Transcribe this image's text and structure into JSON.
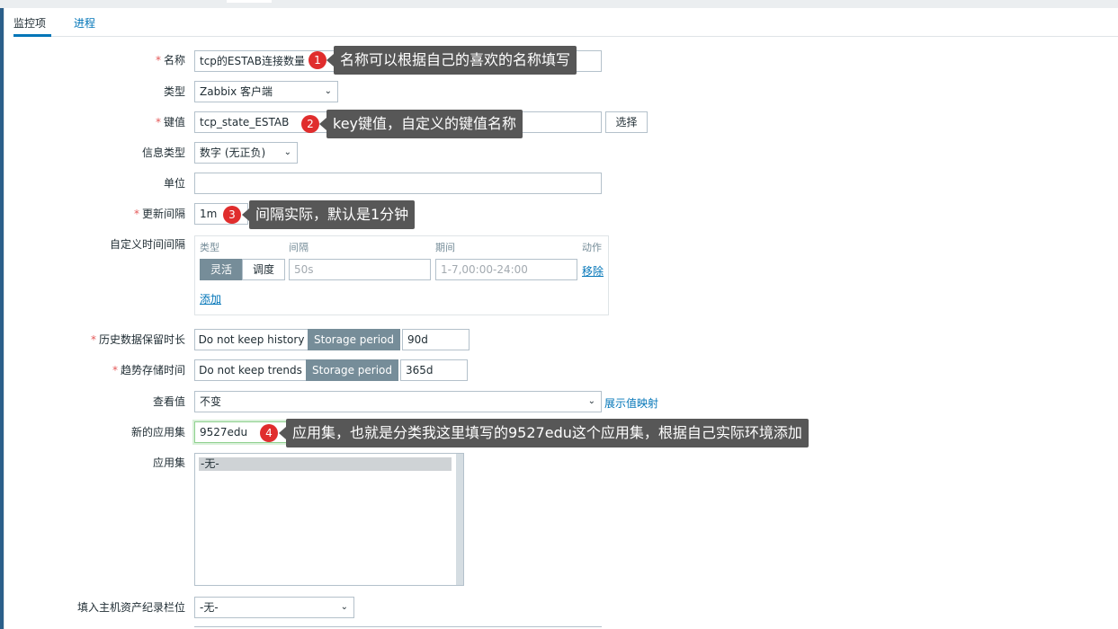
{
  "tabs": [
    {
      "label": "监控项"
    },
    {
      "label": "进程"
    }
  ],
  "form": {
    "name": {
      "label": "名称",
      "value": "tcp的ESTAB连接数量"
    },
    "type": {
      "label": "类型",
      "value": "Zabbix 客户端"
    },
    "key": {
      "label": "键值",
      "value": "tcp_state_ESTAB",
      "select_btn": "选择"
    },
    "info_type": {
      "label": "信息类型",
      "value": "数字 (无正负)"
    },
    "units": {
      "label": "单位",
      "value": ""
    },
    "interval": {
      "label": "更新间隔",
      "value": "1m"
    },
    "custom_intervals": {
      "label": "自定义时间间隔",
      "headers": {
        "type": "类型",
        "interval": "间隔",
        "period": "期间",
        "action": "动作"
      },
      "mode_flexible": "灵活",
      "mode_scheduling": "调度",
      "interval_placeholder": "50s",
      "period_placeholder": "1-7,00:00-24:00",
      "remove": "移除",
      "add": "添加"
    },
    "history": {
      "label": "历史数据保留时长",
      "opt1": "Do not keep history",
      "opt2": "Storage period",
      "value": "90d"
    },
    "trends": {
      "label": "趋势存储时间",
      "opt1": "Do not keep trends",
      "opt2": "Storage period",
      "value": "365d"
    },
    "valuemap": {
      "label": "查看值",
      "value": "不变",
      "link": "展示值映射"
    },
    "new_app": {
      "label": "新的应用集",
      "value": "9527edu"
    },
    "apps": {
      "label": "应用集",
      "option": "-无-"
    },
    "inventory": {
      "label": "填入主机资产纪录栏位",
      "value": "-无-"
    }
  },
  "annotations": [
    {
      "num": "1",
      "text": "名称可以根据自己的喜欢的名称填写"
    },
    {
      "num": "2",
      "text": "key键值，自定义的键值名称"
    },
    {
      "num": "3",
      "text": "间隔实际，默认是1分钟"
    },
    {
      "num": "4",
      "text": "应用集，也就是分类我这里填写的9527edu这个应用集，根据自己实际环境添加"
    }
  ],
  "colors": {
    "accent": "#0275b8",
    "required": "#e45959",
    "segment_on": "#768d99",
    "callout": "#575757",
    "badge": "#e02d2d"
  }
}
